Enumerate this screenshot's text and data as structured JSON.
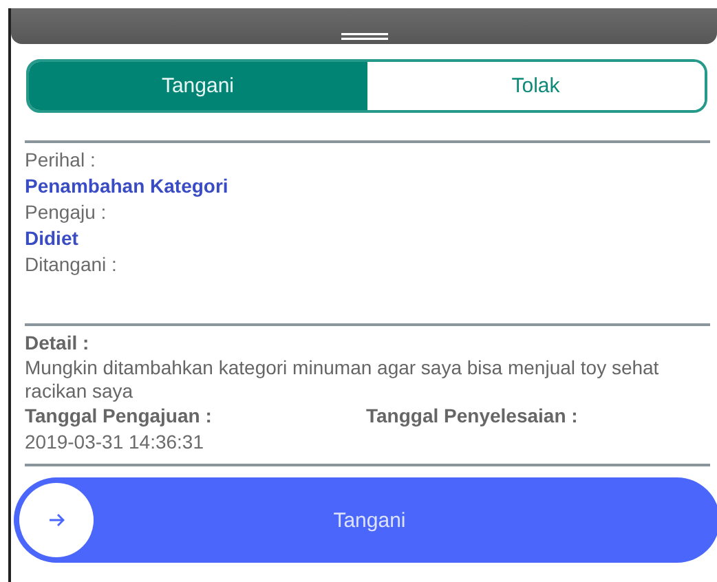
{
  "segments": [
    {
      "label": "Tangani",
      "selected": true
    },
    {
      "label": "Tolak",
      "selected": false
    }
  ],
  "info": [
    {
      "kind": "label",
      "text": "Perihal :"
    },
    {
      "kind": "value",
      "text": "Penambahan Kategori"
    },
    {
      "kind": "label",
      "text": "Pengaju :"
    },
    {
      "kind": "value",
      "text": "Didiet"
    },
    {
      "kind": "label",
      "text": "Ditangani :"
    }
  ],
  "detail": {
    "label": "Detail :",
    "text": "Mungkin ditambahkan kategori minuman agar saya bisa menjual toy sehat racikan saya"
  },
  "dates": [
    {
      "label": "Tanggal Pengajuan :",
      "value": "2019-03-31 14:36:31"
    },
    {
      "label": "Tanggal Penyelesaian :"
    }
  ],
  "action": {
    "label": "Tangani"
  }
}
